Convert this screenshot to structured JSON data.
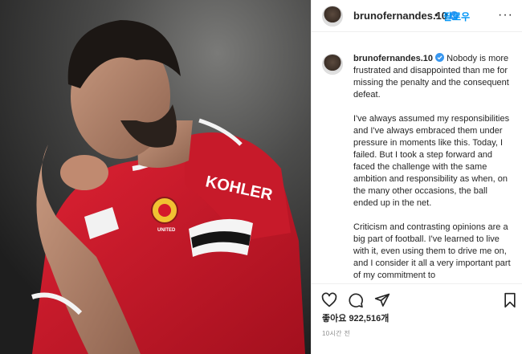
{
  "post": {
    "photo_alt": "",
    "jersey_sponsor": "KOHLER",
    "crest_text": "UNITED",
    "colors": {
      "jersey": "#d4192b",
      "accent": "#0095f6",
      "verified": "#3897f0"
    }
  },
  "header": {
    "username": "brunofernandes.10",
    "separator": "•",
    "follow_label": "팔로우",
    "more_label": "···"
  },
  "caption": {
    "author": "brunofernandes.10",
    "paragraphs": [
      "Nobody is more frustrated and disappointed than me for missing the penalty and the consequent defeat.",
      "I've always assumed my responsibilities and I've always embraced them under pressure in moments like this. Today, I failed. But I took a step forward and faced the challenge with the same ambition and responsibility as when, on the many other occasions, the ball ended up in the net.",
      "Criticism and contrasting opinions are a big part of football. I've learned to live with it, even using them to drive me on, and I consider it all a very important part of my commitment to"
    ]
  },
  "actions": {
    "icons": [
      "heart-icon",
      "comment-icon",
      "share-icon",
      "bookmark-icon"
    ],
    "likes_label": "좋아요",
    "likes_count": "922,516개",
    "time_ago": "10시간 전"
  }
}
